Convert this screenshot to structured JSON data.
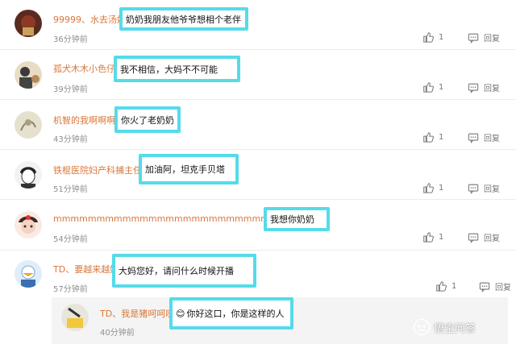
{
  "comments": [
    {
      "user": "99999、水去汤姆",
      "text": "奶奶我朋友他爷爷想相个老伴",
      "time": "36分钟前",
      "likes": "1",
      "reply_label": "回复"
    },
    {
      "user": "孤犬木木小色仔",
      "text": "我不相信，大妈不不可能",
      "time": "39分钟前",
      "likes": "1",
      "reply_label": "回复"
    },
    {
      "user": "机智的我啊啊啊",
      "text": "你火了老奶奶",
      "time": "43分钟前",
      "likes": "1",
      "reply_label": "回复"
    },
    {
      "user": "铁棍医院妇产科捕主任",
      "text": "加油阿，坦克手贝塔",
      "time": "51分钟前",
      "likes": "1",
      "reply_label": "回复"
    },
    {
      "user": "mmmmmmmmmmmmmmmmmmmmmmmmmmmmmmd",
      "text": "我想你奶奶",
      "time": "54分钟前",
      "likes": "1",
      "reply_label": "回复"
    },
    {
      "user": "TD、要越来越好",
      "text": "大妈您好，请问什么时候开播",
      "time": "57分钟前",
      "likes": "1",
      "reply_label": "回复"
    }
  ],
  "nested_reply": {
    "user": "TD、我是猪呵呵哒",
    "text": "你好这口，你是这样的人",
    "emoji": "😊",
    "time": "40分钟前"
  },
  "watermark": {
    "text": "悟空问答"
  },
  "colors": {
    "username": "#d9773a",
    "highlight_border": "#55dbea",
    "time": "#8f8f8f"
  }
}
